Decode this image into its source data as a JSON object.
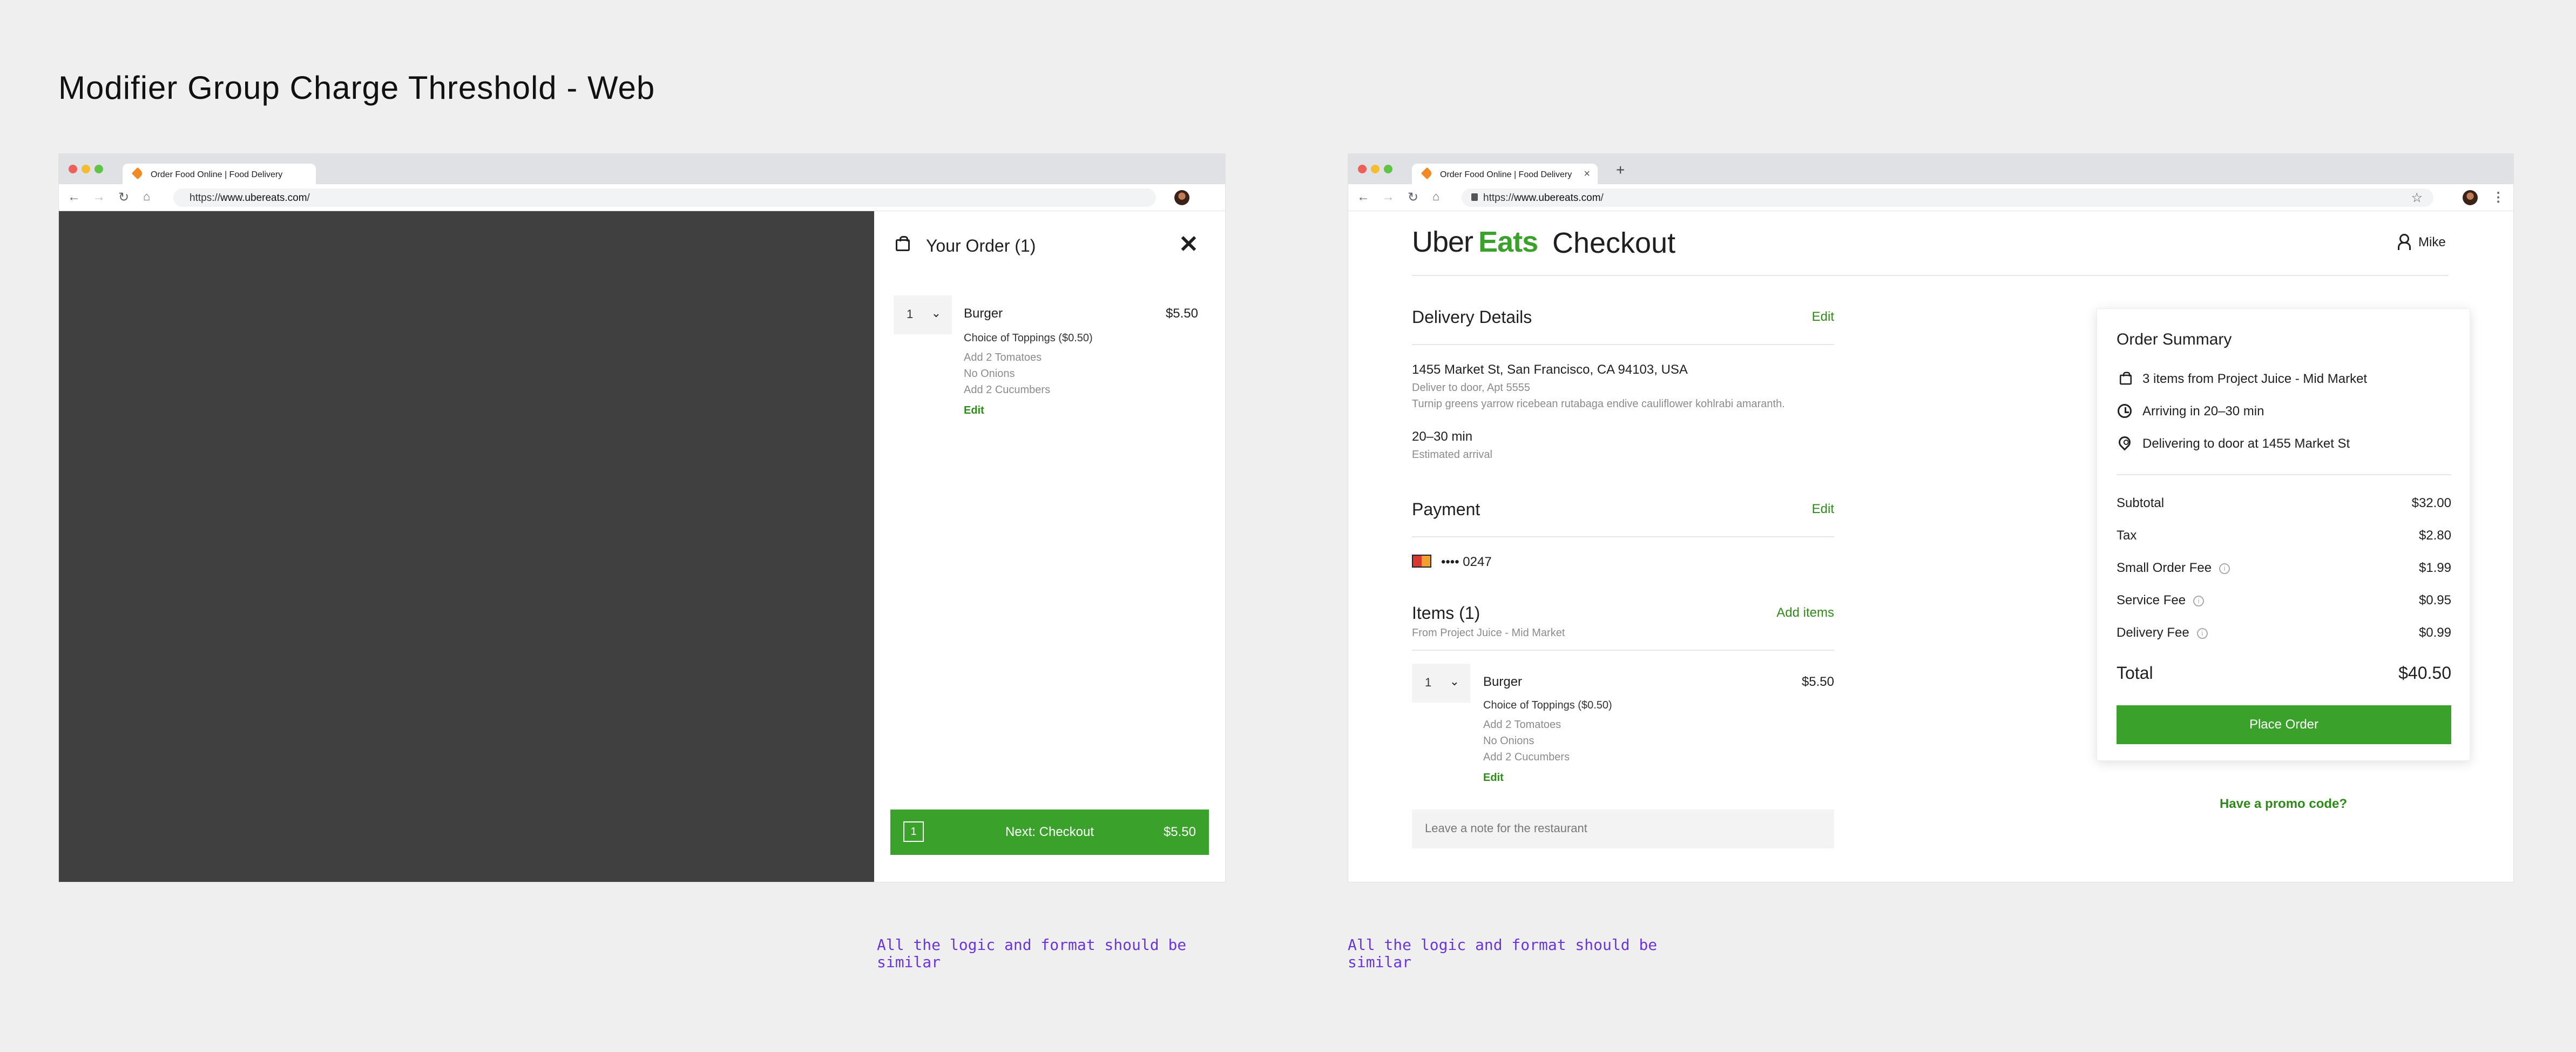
{
  "page_title": "Modifier Group Charge Threshold - Web",
  "notes": [
    "All the logic and format should be similar",
    "All the logic and format should be similar"
  ],
  "browser": {
    "tab_title": "Order Food Online | Food Delivery",
    "url_scheme": "https://",
    "url_host": "www.ubereats.com",
    "url_path": "/"
  },
  "cart_drawer": {
    "title": "Your Order (1)",
    "item": {
      "qty": "1",
      "name": "Burger",
      "price": "$5.50",
      "group": "Choice of Toppings ($0.50)",
      "options": [
        "Add 2 Tomatoes",
        "No Onions",
        "Add 2 Cucumbers"
      ],
      "edit": "Edit"
    },
    "checkout_button": {
      "count": "1",
      "label": "Next: Checkout",
      "price": "$5.50"
    }
  },
  "checkout": {
    "logo_uber": "Uber",
    "logo_eats": "Eats",
    "heading": "Checkout",
    "user_name": "Mike",
    "delivery": {
      "title": "Delivery Details",
      "edit": "Edit",
      "address": "1455 Market St, San Francisco, CA 94103, USA",
      "instructions": "Deliver to door, Apt 5555",
      "note": "Turnip greens yarrow ricebean rutabaga endive cauliflower kohlrabi amaranth.",
      "eta": "20–30 min",
      "eta_label": "Estimated arrival"
    },
    "payment": {
      "title": "Payment",
      "edit": "Edit",
      "card": "•••• 0247"
    },
    "items": {
      "title": "Items (1)",
      "add": "Add items",
      "from": "From Project Juice - Mid Market",
      "item": {
        "qty": "1",
        "name": "Burger",
        "price": "$5.50",
        "group": "Choice of Toppings ($0.50)",
        "options": [
          "Add 2 Tomatoes",
          "No Onions",
          "Add 2 Cucumbers"
        ],
        "edit": "Edit"
      },
      "note_placeholder": "Leave a note for the restaurant"
    },
    "summary": {
      "title": "Order Summary",
      "details": [
        "3 items from Project Juice - Mid Market",
        "Arriving in 20–30 min",
        "Delivering to door at 1455 Market St"
      ],
      "lines": [
        {
          "label": "Subtotal",
          "value": "$32.00"
        },
        {
          "label": "Tax",
          "value": "$2.80"
        },
        {
          "label": "Small Order Fee",
          "value": "$1.99"
        },
        {
          "label": "Service Fee",
          "value": "$0.95"
        },
        {
          "label": "Delivery Fee",
          "value": "$0.99"
        }
      ],
      "total_label": "Total",
      "total_value": "$40.50",
      "place_order": "Place Order",
      "promo": "Have a promo code?"
    }
  }
}
